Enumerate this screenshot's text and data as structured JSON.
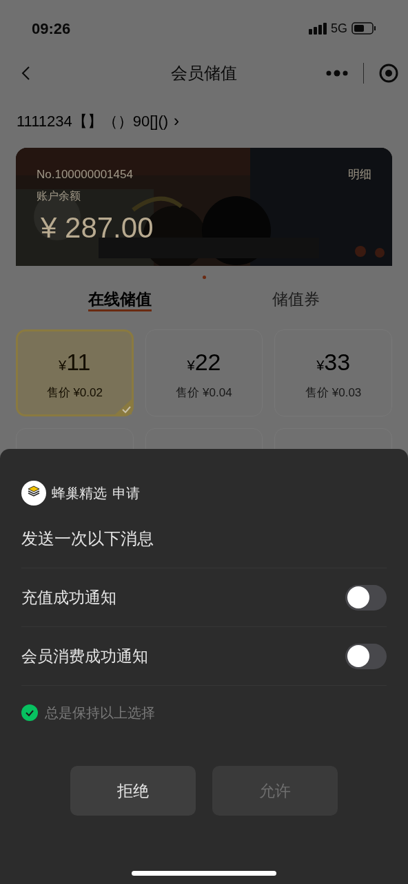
{
  "status_bar": {
    "time": "09:26",
    "network": "5G"
  },
  "nav": {
    "title": "会员储值"
  },
  "store_line": "1111234【】（）90[]()",
  "store_arrow": "›",
  "card": {
    "number": "No.100000001454",
    "detail_link": "明细",
    "balance_label": "账户余额",
    "balance": "¥ 287.00"
  },
  "tabs": [
    {
      "label": "在线储值",
      "selected": true
    },
    {
      "label": "储值券",
      "selected": false
    }
  ],
  "packages": [
    {
      "currency": "¥",
      "amount": "11",
      "price": "售价 ¥0.02",
      "selected": true
    },
    {
      "currency": "¥",
      "amount": "22",
      "price": "售价 ¥0.04",
      "selected": false
    },
    {
      "currency": "¥",
      "amount": "33",
      "price": "售价 ¥0.03",
      "selected": false
    }
  ],
  "sheet": {
    "app_name": "蜂巢精选",
    "request": "申请",
    "heading": "发送一次以下消息",
    "options": [
      {
        "label": "充值成功通知",
        "on": false
      },
      {
        "label": "会员消费成功通知",
        "on": false
      }
    ],
    "remember": {
      "label": "总是保持以上选择",
      "checked": true
    },
    "buttons": [
      {
        "label": "拒绝",
        "disabled": false
      },
      {
        "label": "允许",
        "disabled": true
      }
    ]
  }
}
